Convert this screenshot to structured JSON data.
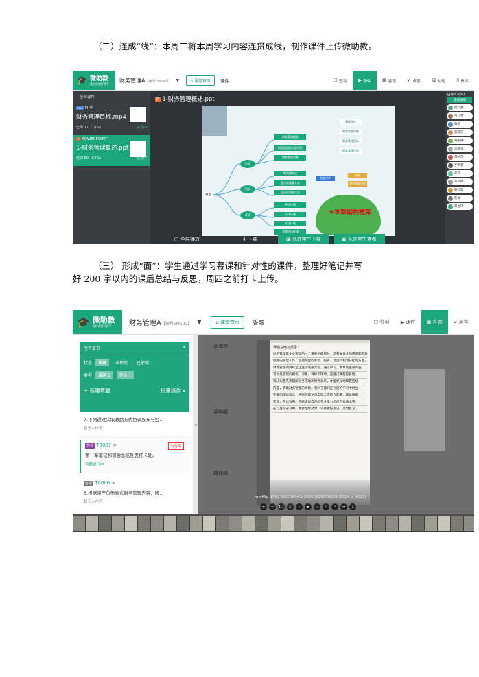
{
  "para1": "（二）连成“线”：本周二将本周学习内容连贯成线，制作课件上传微助教。",
  "para2a": "（三） 形成“面”：学生通过学习慕课和针对性的课件，整理好笔记并写",
  "para2b": "好 200 字以内的课后总结与反思，周四之前打卡上传。",
  "shot1": {
    "logo_title": "微助教",
    "logo_sub": "随时课堂好帮手",
    "course": "财务管理A",
    "course_code": "【编号EM592】",
    "home": "课堂首页",
    "current": "课件",
    "tabs": [
      {
        "icon": "☐",
        "label": "签到"
      },
      {
        "icon": "▶",
        "label": "课件"
      },
      {
        "icon": "▦",
        "label": "答题"
      },
      {
        "icon": "✔",
        "label": "点答"
      },
      {
        "icon": "☊",
        "label": "讨论"
      },
      {
        "icon": "▯",
        "label": "反评"
      }
    ],
    "back": "全部课件",
    "files": [
      {
        "type": "MP4",
        "name": "财务管理目标.mp4",
        "read": "已阅 17（18%）",
        "status": "进行中"
      },
      {
        "type": "POWERPOINT",
        "name": "1-财务管理概述.ppt",
        "read": "已阅 60（64%）",
        "status": "进行中"
      }
    ],
    "viewer_title": "1-财务管理概述.ppt",
    "mindmap": {
      "center": "财 管",
      "branches": [
        "内容",
        "目标",
        "环境"
      ],
      "leaves": [
        "财务管理概念",
        "财务管理的内容特征",
        "财务管理对象",
        "财务管理目标",
        "利润最大化",
        "股东财富最大化",
        "企业价值最大化",
        "各种目标",
        "经济环境",
        "法律环境",
        "文化环境",
        "金融市场环境"
      ],
      "right": [
        "基础理论",
        "财务管理对象",
        "财务管理目标",
        "财务管理环境",
        "利益冲突",
        "协调"
      ],
      "cloud": "★本章结构框架"
    },
    "bottom": [
      "全屏播放",
      "下载",
      "允许学生下载",
      "允许学生查看"
    ],
    "students_count": "已阅人次 60",
    "detail": "查看详情",
    "students": [
      "杨兵燕",
      "韦寸雪",
      "钟新",
      "黄容钰",
      "胡永婷",
      "吴晓萍",
      "苏柏杰",
      "罗俐蓉",
      "邓琼",
      "韦凤梅",
      "钟桂蓉",
      "陈亦",
      "黄进环"
    ]
  },
  "shot2": {
    "logo_title": "微助教",
    "logo_sub": "随时课堂好帮手",
    "course": "财务管理A",
    "course_code": "【编号EM592】",
    "home": "课堂首页",
    "current": "答题",
    "tabs": [
      {
        "icon": "☐",
        "label": "签到"
      },
      {
        "icon": "▶",
        "label": "课件"
      },
      {
        "icon": "▦",
        "label": "答题"
      },
      {
        "icon": "✔",
        "label": "点答"
      }
    ],
    "chapter": "所有章节",
    "filters": [
      {
        "label": "状态",
        "opts": [
          "草稿",
          "未使用",
          "已使用"
        ]
      },
      {
        "label": "类型",
        "opts": [
          "课题 5",
          "作业 1"
        ]
      }
    ],
    "new": "新建章题",
    "batch": "批量操作",
    "items": [
      {
        "title": "7.下列通过采取激励方式协调股东与经...",
        "sub": "暂无人作答",
        "badge": "",
        "code": "",
        "status": ""
      },
      {
        "title": "第一章笔记和课后总结反思打卡处。",
        "sub": "答题进行中",
        "badge": "作业",
        "code": "T0007",
        "status": "行行中"
      },
      {
        "title": "6.根据资产负债表式财务管理内容，股...",
        "sub": "暂无人作答",
        "badge": "客观",
        "code": "T0006",
        "status": ""
      }
    ],
    "names": [
      "孙海林",
      "吴旭娜",
      "林泳晴"
    ],
    "filename": "mmNtp-156270810874 0-20200226070828 (3024 × 4032)",
    "note_title": "课后总结与反思：",
    "note_lines": [
      "财务管理是企业管理的一个重要组成部分，是有关资金的获得和有效",
      "使用的管理工作，包括资金的筹措、投资、营运和利润分配等方面。",
      "财务管理的目标是企业价值最大化，通过学习，本章的主要内容",
      "有财务管理的概念、对象、目标和环境，是整门课程的基础。",
      "我认为首先要理解财务活动和财务关系，才能更好地掌握后续",
      "内容，明确财务管理的目标，有利于我们在今后的学习中树立",
      "正确的理财观念，把财务理论与实际工作结合起来，理论联系",
      "实际，学以致用，不断提高自己的专业能力和综合素质水平。",
      "在以后的学习中，我会继续努力，认真做好笔记，及时复习。"
    ]
  }
}
